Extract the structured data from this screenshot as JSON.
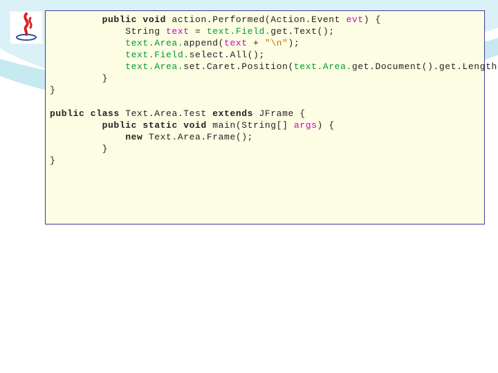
{
  "code": {
    "l1_kw": "public void",
    "l1_rest_a": " action.Performed(Action.Event ",
    "l1_var": "evt",
    "l1_rest_b": ") {",
    "l2_a": "String ",
    "l2_var": "text",
    "l2_b": " = ",
    "l2_typ": "text.Field.",
    "l2_c": "get.Text();",
    "l3_typ": "text.Area.",
    "l3_a": "append(",
    "l3_var": "text",
    "l3_b": " + ",
    "l3_str": "\"\\n\"",
    "l3_c": ");",
    "l4_typ": "text.Field.",
    "l4_a": "select.All();",
    "l5_typ1": "text.Area.",
    "l5_a": "set.Caret.Position(",
    "l5_typ2": "text.Area.",
    "l5_b": "get.Document().get.Length());",
    "l6": "}",
    "l7": "}",
    "l9_kw1": "public class",
    "l9_a": " Text.Area.Test ",
    "l9_kw2": "extends",
    "l9_b": " JFrame {",
    "l10_kw": "public static void",
    "l10_a": " main(String[] ",
    "l10_var": "args",
    "l10_b": ") {",
    "l11_kw": "new",
    "l11_a": " Text.Area.Frame();",
    "l12": "}",
    "l13": "}"
  }
}
